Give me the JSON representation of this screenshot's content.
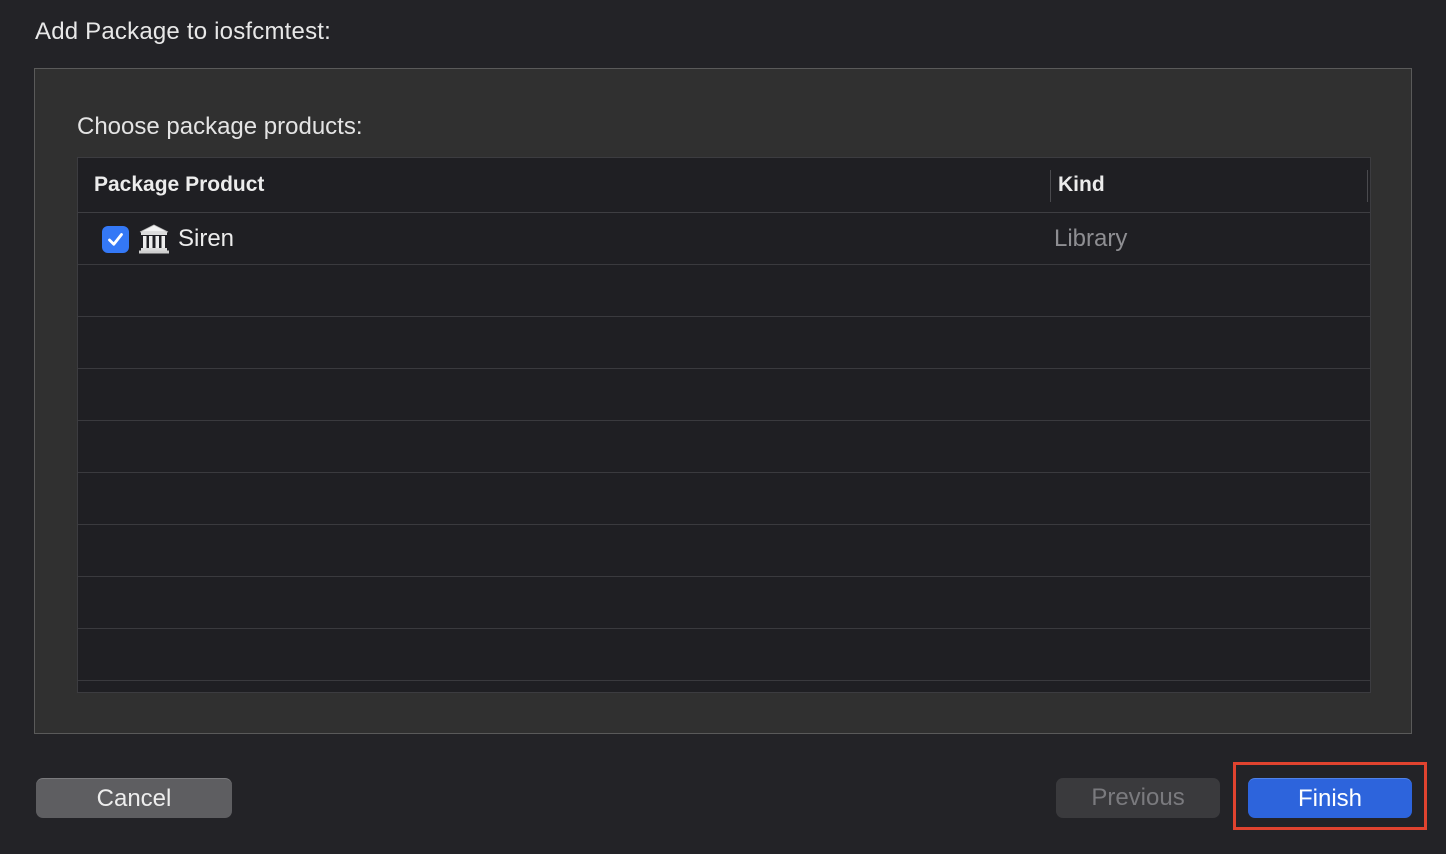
{
  "dialog": {
    "title": "Add Package to iosfcmtest:"
  },
  "content": {
    "section_label": "Choose package products:"
  },
  "table": {
    "columns": [
      {
        "label": "Package Product"
      },
      {
        "label": "Kind"
      }
    ],
    "rows": [
      {
        "checked": true,
        "icon": "library-icon",
        "name": "Siren",
        "kind": "Library"
      }
    ]
  },
  "buttons": {
    "cancel": "Cancel",
    "previous": "Previous",
    "finish": "Finish"
  },
  "colors": {
    "accent": "#2d64dc",
    "checkbox": "#3478f6",
    "highlight": "#e0432f"
  }
}
